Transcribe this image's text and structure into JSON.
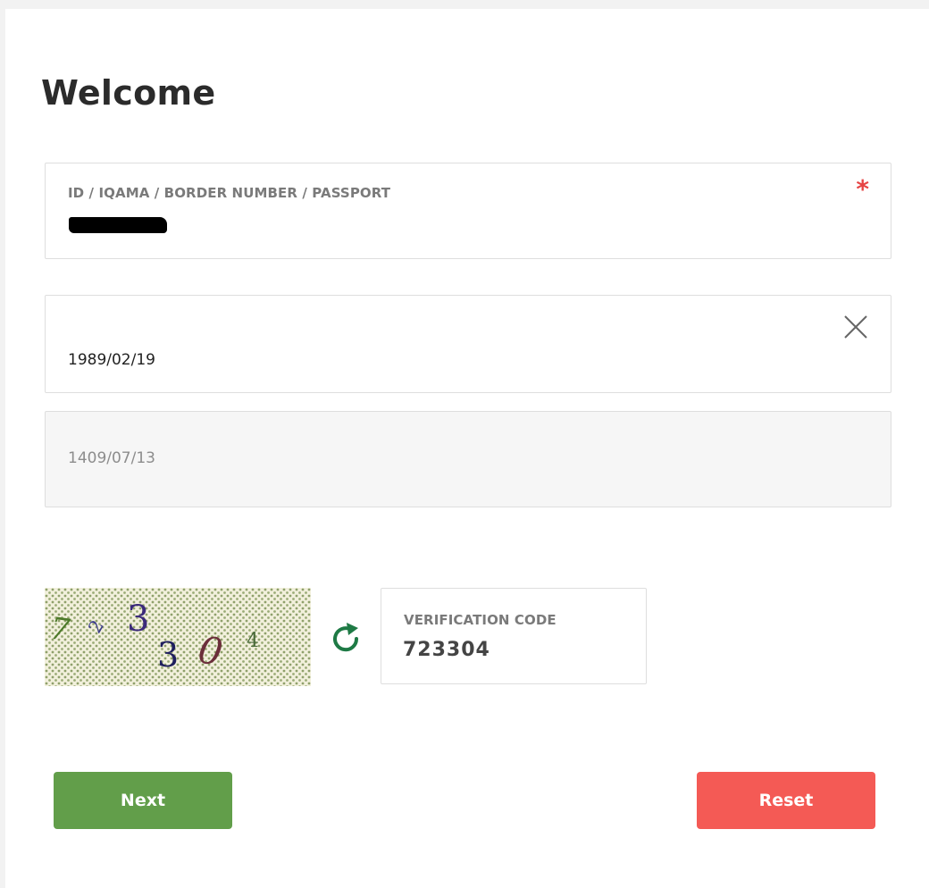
{
  "page": {
    "title": "Welcome"
  },
  "form": {
    "id_field": {
      "label": "ID / IQAMA / BORDER NUMBER / PASSPORT",
      "required_mark": "*"
    },
    "dob_gregorian": {
      "value": "1989/02/19",
      "clear_icon": "close-icon"
    },
    "dob_hijri": {
      "value": "1409/07/13"
    },
    "captcha": {
      "characters": [
        "7",
        "2",
        "3",
        "3",
        "0",
        "4"
      ],
      "refresh_icon": "refresh-icon"
    },
    "verification": {
      "label": "VERIFICATION CODE",
      "value": "723304"
    }
  },
  "actions": {
    "next_label": "Next",
    "reset_label": "Reset"
  },
  "colors": {
    "primary_green": "#629e4a",
    "reset_red": "#f45a55",
    "required_red": "#e64545",
    "refresh_green": "#1e7a45"
  }
}
